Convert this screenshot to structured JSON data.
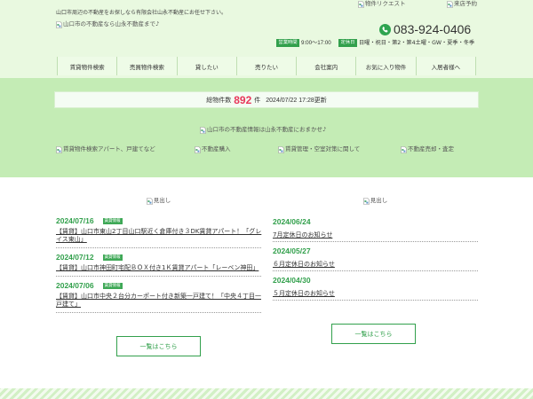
{
  "colors": {
    "header_bg": "#e9f9e0",
    "band_bg": "#c4ecb5",
    "accent": "#32a04c",
    "badge": "#3ea856",
    "count_red": "#e8375a",
    "stripe": "#d2f0c5"
  },
  "icons": {
    "image_placeholder": "broken-image-icon",
    "phone": "phone-icon"
  },
  "header": {
    "tagline": "山口市周辺の不動産をお探しなら有限会社山永不動産にお任せ下さい。",
    "logo_alt": "山口市の不動産なら山永不動産まで♪",
    "request_alt": "物件リクエスト",
    "visit_alt": "来店予約",
    "phone": "083-924-0406",
    "hours_label": "営業時間",
    "hours": "9:00～17:00",
    "holiday_label": "定休日",
    "holidays": "日曜・祝日・第2・第4土曜・GW・夏季・冬季"
  },
  "nav": [
    "賃貸物件検索",
    "売買物件検索",
    "貸したい",
    "売りたい",
    "会社案内",
    "お気に入り物件",
    "入居者様へ"
  ],
  "stats": {
    "label": "総物件数",
    "count": "892",
    "unit": "件",
    "updated": "2024/07/22 17:28更新"
  },
  "hero": {
    "banner_alt": "山口市の不動産情報は山永不動産におまかせ♪",
    "links": [
      "賃貸物件検索アパート、戸建てなど",
      "不動産購入",
      "賃貸管理・空室対策に関して",
      "不動産売却・査定"
    ]
  },
  "news": {
    "heading_alt": "見出し",
    "items": [
      {
        "date": "2024/07/16",
        "tag": "賃貸情報",
        "title": "【賃貸】山口市東山2丁目山口駅近く倉庫付き３DK賃貸アパート！「グレイス東山」"
      },
      {
        "date": "2024/07/12",
        "tag": "賃貸情報",
        "title": "【賃貸】山口市神田町宅配ＢＯＸ付き1Ｋ賃貸アパート「レーベン神田」"
      },
      {
        "date": "2024/07/06",
        "tag": "賃貸情報",
        "title": "【賃貸】山口市中央２台分カーポート付き新築一戸建て！「中央４丁目一戸建て」"
      }
    ],
    "more_label": "一覧はこちら"
  },
  "notices": {
    "heading_alt": "見出し",
    "items": [
      {
        "date": "2024/06/24",
        "title": "7月定休日のお知らせ"
      },
      {
        "date": "2024/05/27",
        "title": "６月定休日のお知らせ"
      },
      {
        "date": "2024/04/30",
        "title": "５月定休日のお知らせ"
      }
    ],
    "more_label": "一覧はこちら"
  }
}
